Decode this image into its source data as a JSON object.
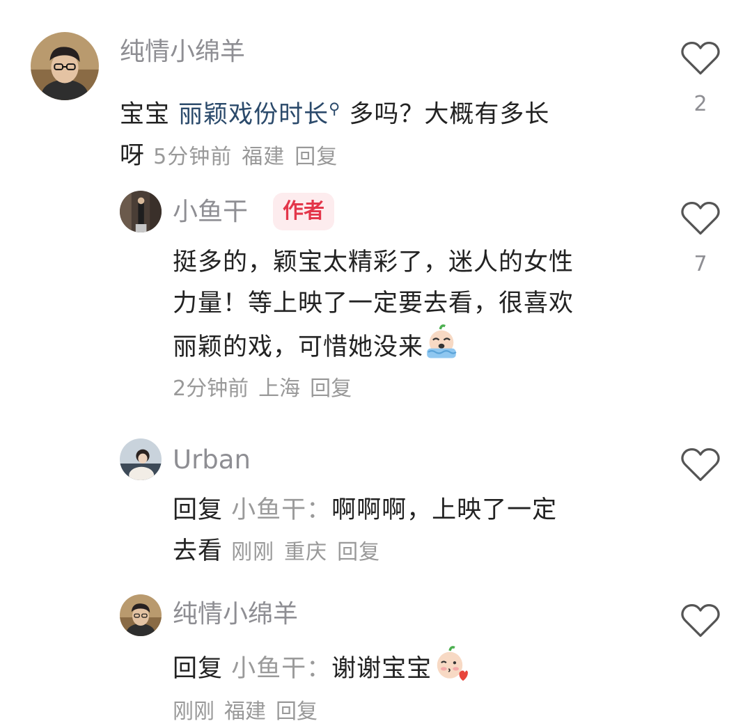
{
  "comments": [
    {
      "username": "纯情小绵羊",
      "text_pre": "宝宝 ",
      "link": "丽颖戏份时长",
      "link_icon": "search-icon",
      "text_post": " 多吗？大概有多长",
      "text_line2": "呀",
      "time": "5分钟前",
      "location": "福建",
      "reply": "回复",
      "likes": "2"
    },
    {
      "username": "小鱼干",
      "badge": "作者",
      "line1": "挺多的，颖宝太精彩了，迷人的女性",
      "line2": "力量！等上映了一定要去看，很喜欢",
      "line3": "丽颖的戏，可惜她没来",
      "emoji": "crying-face-emoji",
      "time": "2分钟前",
      "location": "上海",
      "reply": "回复",
      "likes": "7"
    },
    {
      "username": "Urban",
      "reply_prefix": "回复",
      "reply_to": "小鱼干：",
      "line1": "啊啊啊，上映了一定",
      "line2": "去看",
      "time": "刚刚",
      "location": "重庆",
      "reply": "回复"
    },
    {
      "username": "纯情小绵羊",
      "reply_prefix": "回复",
      "reply_to": "小鱼干：",
      "line1": "谢谢宝宝",
      "emoji": "blowing-kiss-emoji",
      "time": "刚刚",
      "location": "福建",
      "reply": "回复"
    }
  ],
  "colors": {
    "author_badge_bg": "#fdecee",
    "author_badge_text": "#e3364a",
    "username": "#8e8e93",
    "link": "#2b4a6b"
  }
}
